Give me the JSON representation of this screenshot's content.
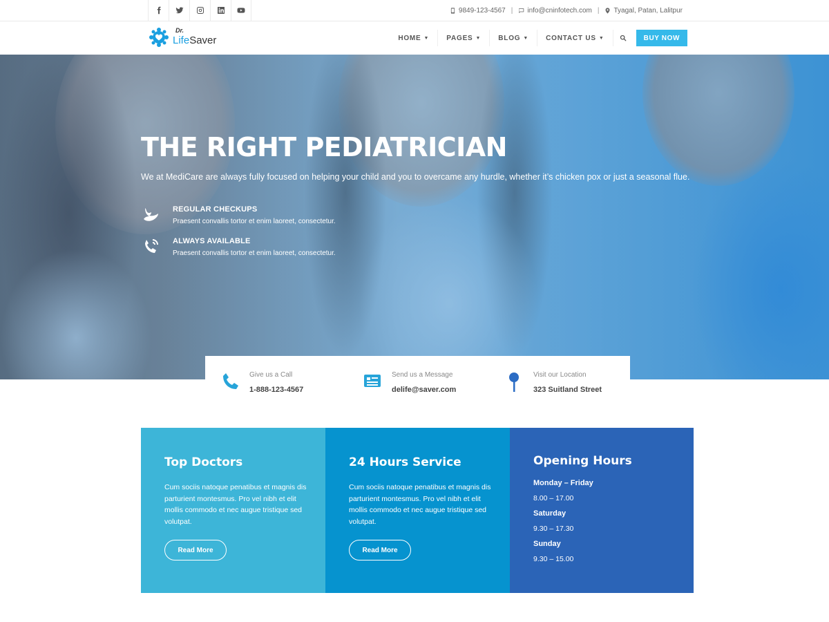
{
  "topbar": {
    "socials": [
      "facebook-icon",
      "twitter-icon",
      "instagram-icon",
      "linkedin-icon",
      "youtube-icon"
    ],
    "phone": "9849-123-4567",
    "email": "info@cninfotech.com",
    "address": "Tyagal, Patan, Lalitpur"
  },
  "header": {
    "logo_dr": "Dr.",
    "logo_part1": "Life",
    "logo_part2": "Saver",
    "nav": [
      "HOME",
      "PAGES",
      "BLOG",
      "CONTACT US"
    ],
    "buy_label": "BUY NOW"
  },
  "hero": {
    "title": "THE RIGHT PEDIATRICIAN",
    "subtitle": "We at MediCare are always fully focused on helping your child and you to overcame any hurdle, whether it’s chicken pox or just a seasonal flue.",
    "features": [
      {
        "title": "REGULAR CHECKUPS",
        "text": "Praesent convallis tortor et enim laoreet, consectetur."
      },
      {
        "title": "ALWAYS AVAILABLE",
        "text": "Praesent convallis tortor et enim laoreet, consectetur."
      }
    ]
  },
  "contact_strip": {
    "call_label": "Give us a Call",
    "call_value": "1-888-123-4567",
    "message_label": "Send us a Message",
    "message_value": "delife@saver.com",
    "location_label": "Visit our Location",
    "location_value": "323 Suitland Street"
  },
  "boxes": {
    "doctors": {
      "title": "Top Doctors",
      "text": "Cum sociis natoque penatibus et magnis dis parturient montesmus. Pro vel nibh et elit mollis commodo et nec augue tristique sed volutpat.",
      "button": "Read More"
    },
    "service": {
      "title": "24 Hours Service",
      "text": "Cum sociis natoque penatibus et magnis dis parturient montesmus. Pro vel nibh et elit mollis commodo et nec augue tristique sed volutpat.",
      "button": "Read More"
    },
    "hours": {
      "title": "Opening Hours",
      "rows": [
        {
          "day": "Monday – Friday",
          "time": "8.00 – 17.00"
        },
        {
          "day": "Saturday",
          "time": "9.30 – 17.30"
        },
        {
          "day": "Sunday",
          "time": "9.30 – 15.00"
        }
      ]
    }
  },
  "colors": {
    "accent": "#35b9ea",
    "box1": "#3db5d8",
    "box2": "#0693cf",
    "box3": "#2b64b7"
  }
}
